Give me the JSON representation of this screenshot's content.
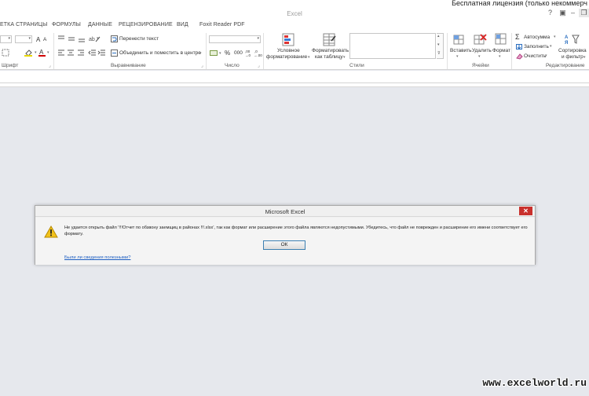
{
  "license_text": "Бесплатная лицензия (только некоммерч",
  "window": {
    "title": "Excel"
  },
  "tabs": [
    "ЕТКА СТРАНИЦЫ",
    "ФОРМУЛЫ",
    "ДАННЫЕ",
    "РЕЦЕНЗИРОВАНИЕ",
    "ВИД",
    "Foxit Reader PDF"
  ],
  "ribbon": {
    "font": {
      "label": "Шрифт",
      "grow": "A",
      "shrink": "A"
    },
    "alignment": {
      "label": "Выравнивание",
      "wrap_text": "Перенести текст",
      "merge_center": "Объединить и поместить в центре"
    },
    "number": {
      "label": "Число",
      "percent": "%",
      "thousands": "000"
    },
    "styles": {
      "label": "Стили",
      "conditional_1": "Условное",
      "conditional_2": "форматирование",
      "format_table_1": "Форматировать",
      "format_table_2": "как таблицу"
    },
    "cells": {
      "label": "Ячейки",
      "insert": "Вставить",
      "delete": "Удалить",
      "format": "Формат"
    },
    "editing": {
      "label": "Редактирование",
      "autosum": "Автосумма",
      "fill": "Заполнить",
      "clear": "Очистить",
      "sort_1": "Сортировка",
      "sort_2": "и фильтр"
    }
  },
  "dialog": {
    "title": "Microsoft Excel",
    "close": "✕",
    "message": "Не удается открыть файл '!!!Отчет по обзвону заемщиц в районах !!!.xlsx', так как формат или расширение этого файла являются недопустимыми. Убедитесь, что файл не поврежден и расширение его имени соответствует его формату.",
    "ok": "ОК",
    "link": "Были ли сведения полезными?"
  },
  "watermark": "www.excelworld.ru",
  "colors": {
    "accent": "#217346",
    "close_red": "#c9302c",
    "link": "#1d5ec2",
    "warning": "#e8b70a"
  }
}
